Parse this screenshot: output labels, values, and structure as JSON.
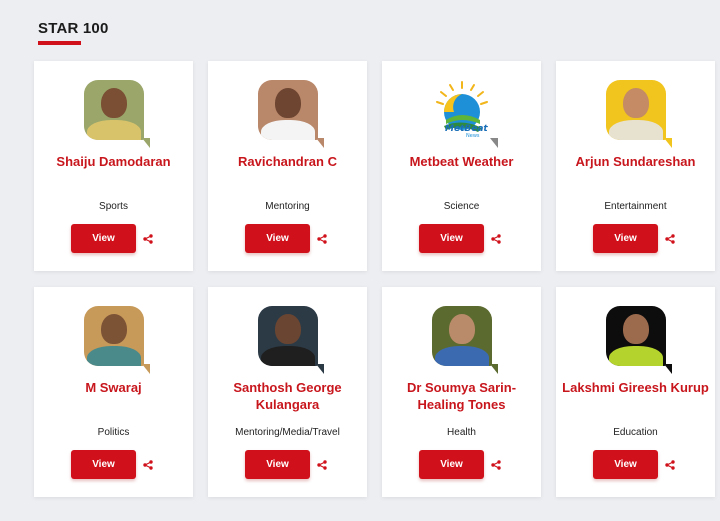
{
  "section": {
    "title": "STAR 100"
  },
  "cards": [
    {
      "name": "Shaiju Damodaran",
      "category": "Sports",
      "view_label": "View",
      "colors": {
        "bg": "#9aa66a",
        "skin": "#7a4f33",
        "shirt": "#d9c36a"
      }
    },
    {
      "name": "Ravichandran C",
      "category": "Mentoring",
      "view_label": "View",
      "colors": {
        "bg": "#b9876a",
        "skin": "#6e4530",
        "shirt": "#f4f4f4"
      }
    },
    {
      "name": "Metbeat Weather",
      "category": "Science",
      "view_label": "View",
      "logo": "metbeat-weather-logo"
    },
    {
      "name": "Arjun Sundareshan",
      "category": "Entertainment",
      "view_label": "View",
      "colors": {
        "bg": "#f1c51e",
        "skin": "#c48b64",
        "shirt": "#e7e1cf"
      }
    },
    {
      "name": "M Swaraj",
      "category": "Politics",
      "view_label": "View",
      "colors": {
        "bg": "#c79a5a",
        "skin": "#7d5336",
        "shirt": "#4b8a8a"
      }
    },
    {
      "name": "Santhosh George Kulangara",
      "category": "Mentoring/Media/Travel",
      "view_label": "View",
      "colors": {
        "bg": "#2c3a46",
        "skin": "#6a4532",
        "shirt": "#1f1f1f"
      }
    },
    {
      "name": "Dr Soumya Sarin-Healing Tones",
      "category": "Health",
      "view_label": "View",
      "colors": {
        "bg": "#5b6a2f",
        "skin": "#b98b6a",
        "shirt": "#3c6ab0"
      }
    },
    {
      "name": "Lakshmi Gireesh Kurup",
      "category": "Education",
      "view_label": "View",
      "colors": {
        "bg": "#0d0d0d",
        "skin": "#9c6b4e",
        "shirt": "#b4d32c"
      }
    }
  ],
  "colors": {
    "accent": "#d0111b",
    "name_text": "#c8161d"
  },
  "icons": {
    "share": "share-icon"
  }
}
